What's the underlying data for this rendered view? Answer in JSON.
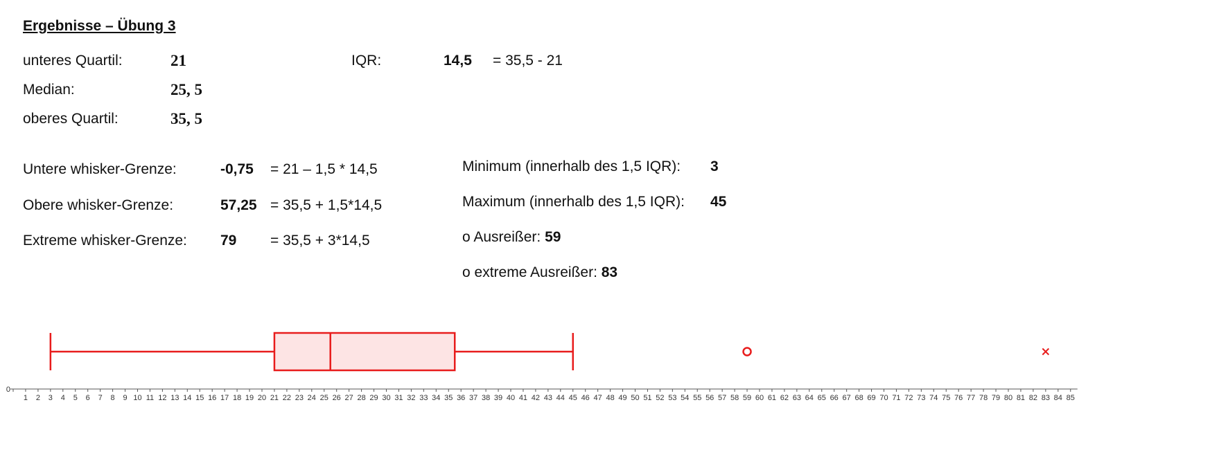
{
  "title": "Ergebnisse – Übung 3",
  "stats": {
    "lower_quartile_label": "unteres Quartil:",
    "lower_quartile_value": "21",
    "median_label": "Median:",
    "median_value": "25, 5",
    "upper_quartile_label": "oberes Quartil:",
    "upper_quartile_value": "35, 5",
    "iqr_label": "IQR:",
    "iqr_value": "14,5",
    "iqr_formula": "= 35,5 - 21"
  },
  "whiskers": {
    "lower_label": "Untere whisker-Grenze:",
    "lower_value": "-0,75",
    "lower_formula": "= 21 – 1,5 * 14,5",
    "upper_label": "Obere whisker-Grenze:",
    "upper_value": "57,25",
    "upper_formula": "= 35,5 + 1,5*14,5",
    "extreme_label": "Extreme whisker-Grenze:",
    "extreme_value": "79",
    "extreme_formula": "= 35,5 + 3*14,5"
  },
  "extremes": {
    "min_label": "Minimum (innerhalb des 1,5 IQR):",
    "min_value": "3",
    "max_label": "Maximum (innerhalb des 1,5 IQR):",
    "max_value": "45",
    "outlier_label": "o Ausreißer:",
    "outlier_value": "59",
    "extreme_outlier_label": "o extreme Ausreißer:",
    "extreme_outlier_value": "83"
  },
  "chart_data": {
    "type": "boxplot",
    "orientation": "horizontal",
    "whisker_low": 3,
    "q1": 21,
    "median": 25.5,
    "q3": 35.5,
    "whisker_high": 45,
    "outliers": [
      59
    ],
    "extreme_outliers": [
      83
    ],
    "axis_min": 0,
    "axis_max": 85,
    "tick_step": 1,
    "box_color": "#e81c1c",
    "box_fill": "#fde4e4"
  }
}
